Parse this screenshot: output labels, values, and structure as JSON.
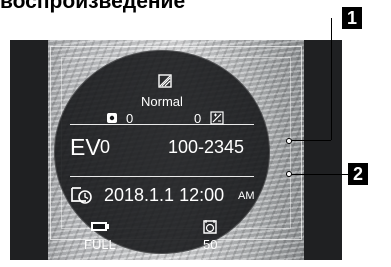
{
  "title": "воспроизведение",
  "overlay": {
    "mode_label": "Normal",
    "left_value": "0",
    "right_value": "0",
    "ev_label": "EV",
    "ev_value": "0",
    "file_number": "100-2345",
    "datetime": "2018.1.1 12:00",
    "time_suffix": "AM",
    "card_label": "FULL",
    "shot_count": "50"
  },
  "callouts": {
    "one": "1",
    "two": "2"
  },
  "icons": {
    "mode": "picture-style-icon",
    "left": "drive-mode-icon",
    "right": "exposure-compensation-icon",
    "datetime": "date-time-icon",
    "card": "memory-card-icon",
    "shots": "shot-counter-icon"
  },
  "colors": {
    "overlay_background": "#141618",
    "text": "#ffffff",
    "badge": "#000000"
  }
}
